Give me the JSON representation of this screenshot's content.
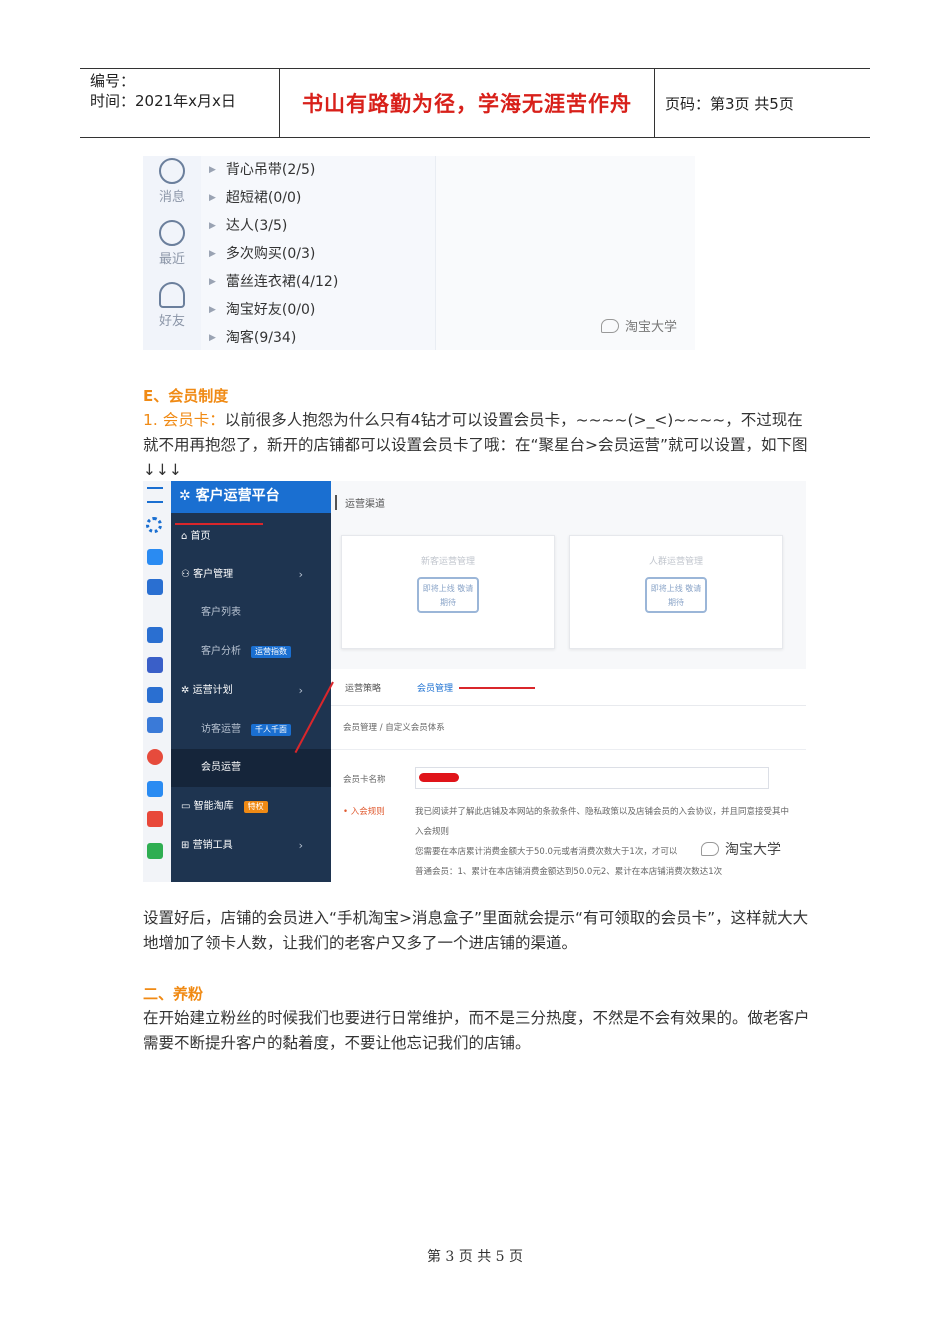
{
  "header": {
    "number_label": "编号：",
    "time_label": "时间：2021年x月x日",
    "motto": "书山有路勤为径，学海无涯苦作舟",
    "page_info": "页码：第3页  共5页"
  },
  "screenshot_contacts": {
    "rail": [
      "消息",
      "最近",
      "好友"
    ],
    "groups": [
      "背心吊带(2/5)",
      "超短裙(0/0)",
      "达人(3/5)",
      "多次购买(0/3)",
      "蕾丝连衣裙(4/12)",
      "淘宝好友(0/0)",
      "淘客(9/34)"
    ],
    "watermark": "淘宝大学"
  },
  "section_e": {
    "heading": "E、会员制度",
    "lead": "1. 会员卡：",
    "text": "以前很多人抱怨为什么只有4钻才可以设置会员卡，~~~~(>_<)~~~~，不过现在就不用再抱怨了，新开的店铺都可以设置会员卡了哦：在“聚星台>会员运营”就可以设置，如下图↓↓↓"
  },
  "screenshot_platform": {
    "brand": "客户运营平台",
    "nav": [
      {
        "label": "首页"
      },
      {
        "label": "客户管理"
      },
      {
        "label": "客户列表"
      },
      {
        "label": "客户分析",
        "tag": "运营指数"
      },
      {
        "label": "运营计划"
      },
      {
        "label": "访客运营",
        "tag": "千人千面"
      },
      {
        "label": "会员运营"
      },
      {
        "label": "智能淘库",
        "tag": "特权"
      },
      {
        "label": "营销工具"
      }
    ],
    "section_title": "运营渠道",
    "cards": [
      {
        "title": "新客运营管理",
        "stamp": "即将上线 敬请期待"
      },
      {
        "title": "人群运营管理",
        "stamp": "即将上线 敬请期待"
      }
    ],
    "tabs": [
      "运营策略",
      "会员管理"
    ],
    "breadcrumb": "会员管理 / 自定义会员体系",
    "field_label": "会员卡名称",
    "rule_label": "• 入会规则",
    "rule_lines": [
      "我已阅读并了解此店铺及本网站的条款条件、隐私政策以及店铺会员的入会协议，并且同意接受其中",
      "入会规则",
      "您需要在本店累计消费金额大于50.0元或者消费次数大于1次，才可以",
      "普通会员：1、累计在本店铺消费金额达到50.0元2、累计在本店铺消费次数达1次"
    ],
    "watermark": "淘宝大学"
  },
  "after_shot": {
    "text": "设置好后，店铺的会员进入“手机淘宝>消息盒子”里面就会提示“有可领取的会员卡”，这样就大大地增加了领卡人数，让我们的老客户又多了一个进店铺的渠道。"
  },
  "section_two": {
    "heading": "二、养粉",
    "text": "在开始建立粉丝的时候我们也要进行日常维护，而不是三分热度，不然是不会有效果的。做老客户需要不断提升客户的黏着度，不要让他忘记我们的店铺。"
  },
  "footer": {
    "page": "第 3 页 共 5 页"
  },
  "colors": {
    "accent_orange": "#f08a14",
    "motto_red": "#d8201a",
    "nav_dark": "#1e3450",
    "brand_blue": "#1a6fd1"
  }
}
